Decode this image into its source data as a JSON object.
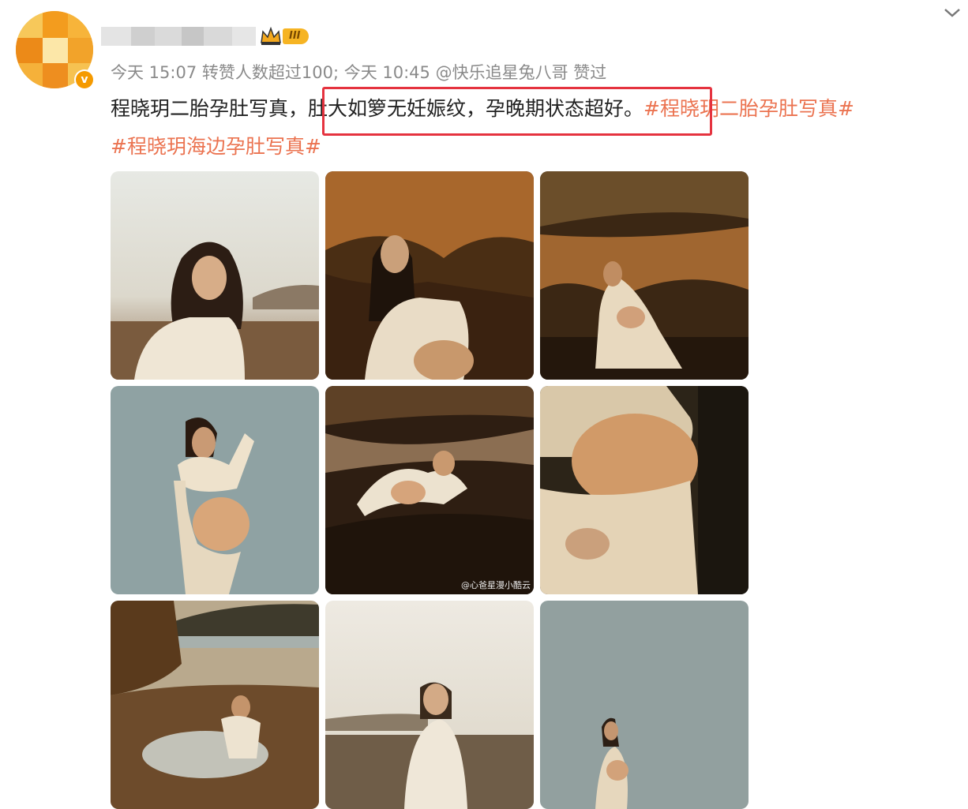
{
  "post": {
    "meta": "今天 15:07 转赞人数超过100; 今天 10:45 @快乐追星兔八哥 赞过",
    "level_badge": "III",
    "text_plain": "程晓玥二胎孕肚写真，",
    "text_highlight": "肚大如箩无妊娠纹，孕晚期状态超好。",
    "hashtag_1": "#程晓玥二胎孕肚写真#",
    "hashtag_2": "#程晓玥海边孕肚写真#",
    "photo_watermark": "@心爸星漫小酷云"
  },
  "icons": {
    "chevron": "chevron-down-icon",
    "verified": "verified-badge-icon",
    "crown": "crown-icon"
  },
  "colors": {
    "hashtag": "#eb7350",
    "highlight_border": "#e5333f",
    "meta_text": "#8a8a8a",
    "level_badge": "#f6b423"
  }
}
